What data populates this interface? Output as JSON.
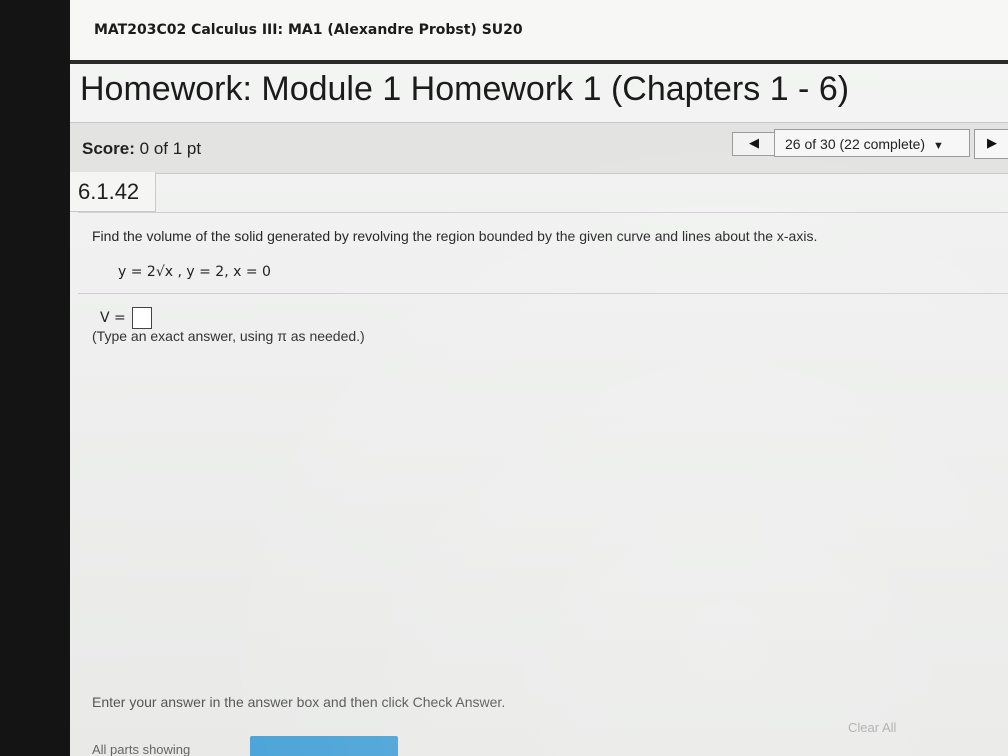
{
  "course": {
    "title": "MAT203C02 Calculus III: MA1 (Alexandre Probst) SU20"
  },
  "assignment": {
    "title": "Homework: Module 1 Homework 1 (Chapters 1 - 6)"
  },
  "score": {
    "label": "Score:",
    "value": "0 of 1 pt"
  },
  "navigation": {
    "prev_glyph": "◀",
    "question_position": "26 of 30 (22 complete)",
    "dropdown_glyph": "▼",
    "next_glyph": "▶"
  },
  "question": {
    "section": "6.1.42",
    "prompt": "Find the volume of the solid generated by revolving the region bounded by the given curve and lines about the x-axis.",
    "equation": "y = 2√x ,  y = 2,  x = 0",
    "answer_label": "V =",
    "answer_value": "",
    "hint": "(Type an exact answer, using π as needed.)"
  },
  "footer": {
    "instructions": "Enter your answer in the answer box and then click Check Answer.",
    "clear_all_label": "Clear All",
    "parts_label": "All parts showing"
  },
  "colors": {
    "title_rule": "#2b2b2b",
    "check_button": "#4aa3d8",
    "score_bar": "#e3e4e2"
  }
}
